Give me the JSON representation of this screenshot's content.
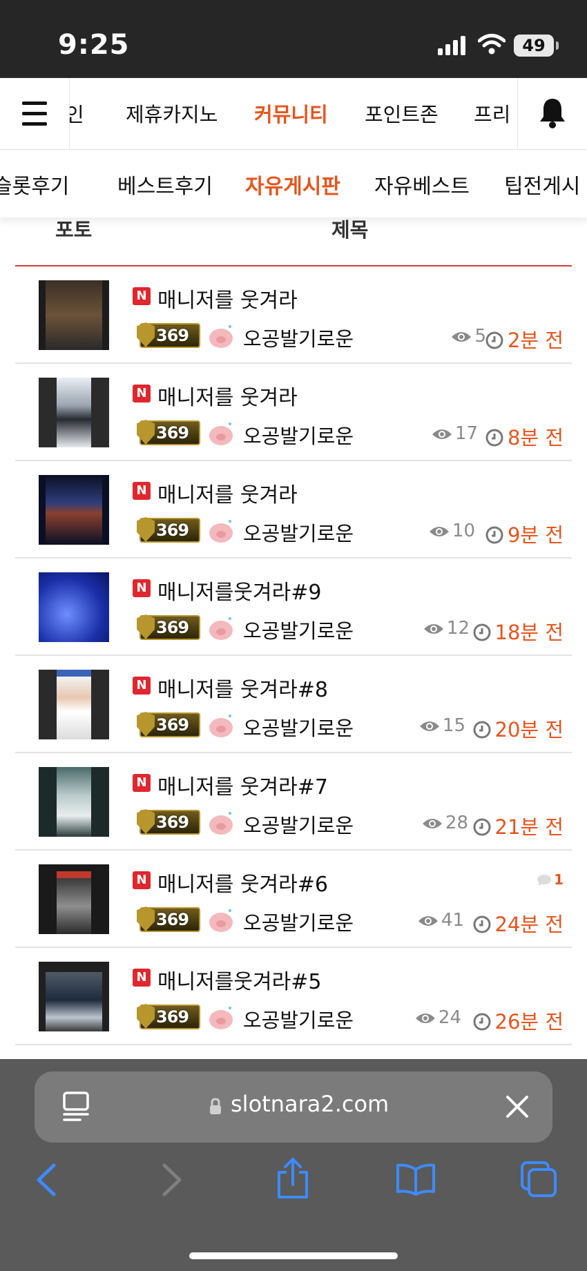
{
  "status_bar": {
    "time": "9:25",
    "battery": "49"
  },
  "main_nav": {
    "items": [
      {
        "label": "인",
        "active": false
      },
      {
        "label": "제휴카지노",
        "active": false
      },
      {
        "label": "커뮤니티",
        "active": true
      },
      {
        "label": "포인트존",
        "active": false
      },
      {
        "label": "프리",
        "active": false
      }
    ]
  },
  "sub_nav": {
    "items": [
      {
        "label": "슬롯후기",
        "active": false
      },
      {
        "label": "베스트후기",
        "active": false
      },
      {
        "label": "자유게시판",
        "active": true
      },
      {
        "label": "자유베스트",
        "active": false
      },
      {
        "label": "팁전게시",
        "active": false
      }
    ]
  },
  "list_header": {
    "photo": "포토",
    "title": "제목"
  },
  "level_badge": "369",
  "posts": [
    {
      "badge": "N",
      "title": "매니저를 웃겨라",
      "author": "오공발기로운",
      "views": "5",
      "time": "2분 전",
      "comments": ""
    },
    {
      "badge": "N",
      "title": "매니저를 웃겨라",
      "author": "오공발기로운",
      "views": "17",
      "time": "8분 전",
      "comments": ""
    },
    {
      "badge": "N",
      "title": "매니저를 웃겨라",
      "author": "오공발기로운",
      "views": "10",
      "time": "9분 전",
      "comments": ""
    },
    {
      "badge": "N",
      "title": "매니저를웃겨라#9",
      "author": "오공발기로운",
      "views": "12",
      "time": "18분 전",
      "comments": ""
    },
    {
      "badge": "N",
      "title": "매니저를 웃겨라#8",
      "author": "오공발기로운",
      "views": "15",
      "time": "20분 전",
      "comments": ""
    },
    {
      "badge": "N",
      "title": "매니저를 웃겨라#7",
      "author": "오공발기로운",
      "views": "28",
      "time": "21분 전",
      "comments": ""
    },
    {
      "badge": "N",
      "title": "매니저를 웃겨라#6",
      "author": "오공발기로운",
      "views": "41",
      "time": "24분 전",
      "comments": "1"
    },
    {
      "badge": "N",
      "title": "매니저를웃겨라#5",
      "author": "오공발기로운",
      "views": "24",
      "time": "26분 전",
      "comments": ""
    }
  ],
  "safari": {
    "url": "slotnara2.com"
  },
  "colors": {
    "accent": "#e8541c",
    "badge_red": "#e0262e",
    "divider_red": "#d43c3c"
  }
}
